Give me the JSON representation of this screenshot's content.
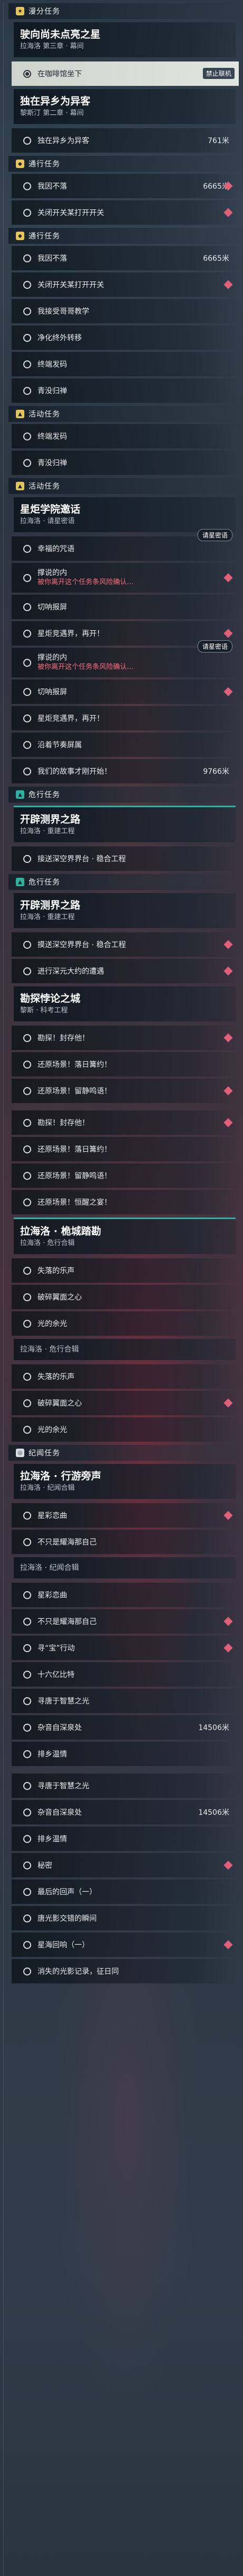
{
  "sections": [
    {
      "type": "category",
      "icon": "★",
      "icon_name": "star-icon",
      "color": "#e6c45a",
      "title": "漫分任务"
    },
    {
      "type": "quest",
      "title": "驶向尚未点亮之星",
      "sub": "拉海洛 第三章 · 幕间"
    },
    {
      "type": "objective",
      "text": "在咖啡馆坐下",
      "selected": true,
      "badge": "禁止联机"
    },
    {
      "type": "quest",
      "title": "独在异乡为异客",
      "sub": "黎斯汀 第二章 · 幕间"
    },
    {
      "type": "objective",
      "text": "独在异乡为异客",
      "dist": "761米"
    },
    {
      "type": "category",
      "icon": "◆",
      "icon_name": "diamond-icon",
      "color": "#e6c45a",
      "title": "通行任务"
    },
    {
      "type": "objective",
      "text": "我因不落",
      "dist": "6665米",
      "pin": true
    },
    {
      "type": "objective",
      "text": "关闭开关某打开开关",
      "pin": true
    },
    {
      "type": "category",
      "icon": "◆",
      "icon_name": "diamond-icon",
      "color": "#e6c45a",
      "title": "通行任务"
    },
    {
      "type": "objective",
      "text": "我因不落",
      "dist": "6665米"
    },
    {
      "type": "objective",
      "text": "关闭开关某打开开关",
      "pin": true
    },
    {
      "type": "objective",
      "text": "我接受哥哥教学"
    },
    {
      "type": "objective",
      "text": "净化终外转移"
    },
    {
      "type": "objective",
      "text": "终端发码"
    },
    {
      "type": "objective",
      "text": "青没归禅"
    },
    {
      "type": "category",
      "icon": "▲",
      "icon_name": "event-icon",
      "color": "#e6c45a",
      "title": "活动任务"
    },
    {
      "type": "objective",
      "text": "终端发码"
    },
    {
      "type": "objective",
      "text": "青没归禅"
    },
    {
      "type": "category",
      "icon": "▲",
      "icon_name": "event-icon",
      "color": "#e6c45a",
      "title": "活动任务"
    },
    {
      "type": "quest",
      "title": "星炬学院邀话",
      "sub": "拉海洛 · 请星密语"
    },
    {
      "type": "objective",
      "text": "幸福的咒语",
      "invite": "请星密语"
    },
    {
      "type": "warn",
      "text": "撑说的内",
      "warn": "被你离开这个任务条风险确认…",
      "pin": true
    },
    {
      "type": "objective",
      "text": "切呐报屏"
    },
    {
      "type": "objective",
      "text": "星炬竞遇界，再开！",
      "pin": true
    },
    {
      "type": "warn",
      "text": "撑说的内",
      "warn": "被你离开这个任务条风险确认…",
      "invite": "请星密语"
    },
    {
      "type": "objective",
      "text": "切呐报屏",
      "pin": true
    },
    {
      "type": "objective",
      "text": "星炬竞遇界，再开！"
    },
    {
      "type": "objective",
      "text": "沿着节奏屏属"
    },
    {
      "type": "objective",
      "text": "我们的故事才刚开始！",
      "dist": "9766米"
    },
    {
      "type": "category",
      "icon": "▲",
      "icon_name": "guild-icon",
      "color": "#2bb3a1",
      "title": "危行任务"
    },
    {
      "type": "quest",
      "title": "开辟测界之路",
      "sub": "拉海洛 · 重建工程",
      "band": "#2bb3a1"
    },
    {
      "type": "objective",
      "text": "接送深空界界台 · 稳合工程"
    },
    {
      "type": "category",
      "icon": "▲",
      "icon_name": "guild-icon",
      "color": "#2bb3a1",
      "title": "危行任务"
    },
    {
      "type": "quest",
      "title": "开辟测界之路",
      "sub": "拉海洛 · 重建工程"
    },
    {
      "type": "objective",
      "text": "摸送深空界界台 · 稳合工程",
      "pin": true
    },
    {
      "type": "objective",
      "text": "进行深元大约的遭遇",
      "pin": true
    },
    {
      "type": "quest",
      "title": "勘探悖论之城",
      "sub": "黎斯 · 科考工程"
    },
    {
      "type": "objective",
      "text": "勘探！封存他！",
      "pin": true
    },
    {
      "type": "objective",
      "text": "还原场景！落日篝约！"
    },
    {
      "type": "objective",
      "text": "还原场景！留静鸣语！",
      "pin": true
    },
    {
      "type": "spacer"
    },
    {
      "type": "objective",
      "text": "勘探！封存他！",
      "pin": true
    },
    {
      "type": "objective",
      "text": "还原场景！落日篝约！"
    },
    {
      "type": "objective",
      "text": "还原场景！留静鸣语！"
    },
    {
      "type": "objective",
      "text": "还原场景！恒醒之宴！"
    },
    {
      "type": "quest",
      "title": "拉海洛 · 桅城踏勘",
      "sub": "拉海洛 · 危行合辑",
      "band": "#2bb3a1"
    },
    {
      "type": "objective",
      "text": "失落的乐声"
    },
    {
      "type": "objective",
      "text": "破碎翼面之心"
    },
    {
      "type": "objective",
      "text": "光的余光"
    },
    {
      "type": "plainhead",
      "text": "拉海洛 · 危行合辑"
    },
    {
      "type": "objective",
      "text": "失落的乐声"
    },
    {
      "type": "objective",
      "text": "破碎翼面之心",
      "pin": true
    },
    {
      "type": "objective",
      "text": "光的余光"
    },
    {
      "type": "category",
      "icon": "◎",
      "icon_name": "pilgrim-icon",
      "color": "#d7dde3",
      "title": "纪闻任务"
    },
    {
      "type": "quest",
      "title": "拉海洛 · 行游旁声",
      "sub": "拉海洛 · 纪闻合辑"
    },
    {
      "type": "objective",
      "text": "星彩恋曲",
      "pin": true
    },
    {
      "type": "objective",
      "text": "不只是耀海那自己"
    },
    {
      "type": "plainhead",
      "text": "拉海洛 · 纪闻合辑"
    },
    {
      "type": "objective",
      "text": "星彩恋曲"
    },
    {
      "type": "objective",
      "text": "不只是耀海那自己",
      "pin": true
    },
    {
      "type": "objective",
      "text": "寻“宝”行动",
      "pin": true
    },
    {
      "type": "objective",
      "text": "十六亿比特"
    },
    {
      "type": "objective",
      "text": "寻唐于智慧之光"
    },
    {
      "type": "objective",
      "text": "杂音自深泉处",
      "dist": "14506米"
    },
    {
      "type": "objective",
      "text": "排乡温情"
    },
    {
      "type": "spacer"
    },
    {
      "type": "objective",
      "text": "寻唐于智慧之光"
    },
    {
      "type": "objective",
      "text": "杂音自深泉处",
      "dist": "14506米"
    },
    {
      "type": "objective",
      "text": "排乡温情"
    },
    {
      "type": "objective",
      "text": "秘密",
      "pin": true
    },
    {
      "type": "objective",
      "text": "最后的回声（一）"
    },
    {
      "type": "objective",
      "text": "唐光影交错的瞬间"
    },
    {
      "type": "objective",
      "text": "星海回响（一）",
      "pin": true
    },
    {
      "type": "objective",
      "text": "消失的光影记录，征日同"
    }
  ]
}
